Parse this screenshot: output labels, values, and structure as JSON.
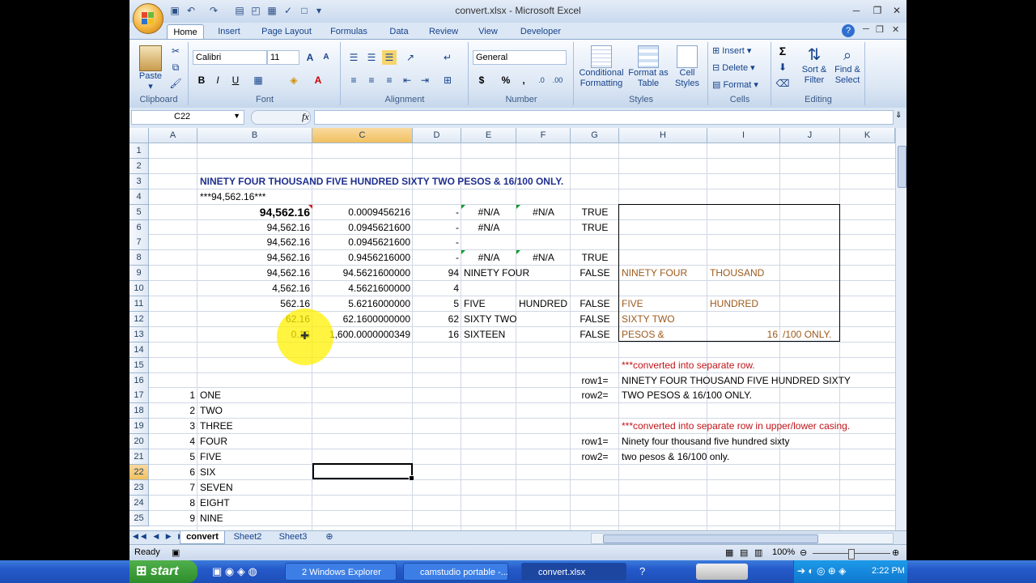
{
  "window": {
    "title": "convert.xlsx - Microsoft Excel"
  },
  "tabs": [
    "Home",
    "Insert",
    "Page Layout",
    "Formulas",
    "Data",
    "Review",
    "View",
    "Developer"
  ],
  "ribbon": {
    "clipboard": {
      "label": "Clipboard",
      "paste": "Paste"
    },
    "font": {
      "label": "Font",
      "name": "Calibri",
      "size": "11",
      "bold": "B",
      "italic": "I",
      "underline": "U"
    },
    "alignment": {
      "label": "Alignment"
    },
    "number": {
      "label": "Number",
      "format": "General",
      "currency": "$",
      "percent": "%",
      "comma": ","
    },
    "styles": {
      "label": "Styles",
      "conditional": "Conditional Formatting",
      "format_table": "Format as Table",
      "cell_styles": "Cell Styles"
    },
    "cells": {
      "label": "Cells",
      "insert": "Insert",
      "delete": "Delete",
      "format": "Format"
    },
    "editing": {
      "label": "Editing",
      "sigma": "Σ",
      "sort": "Sort & Filter",
      "find": "Find & Select"
    }
  },
  "formula_bar": {
    "name_box": "C22",
    "fx": "fx",
    "value": ""
  },
  "columns": [
    "A",
    "B",
    "C",
    "D",
    "E",
    "F",
    "G",
    "H",
    "I",
    "J",
    "K"
  ],
  "rows": [
    "1",
    "2",
    "3",
    "4",
    "5",
    "6",
    "7",
    "8",
    "9",
    "10",
    "11",
    "12",
    "13",
    "14",
    "15",
    "16",
    "17",
    "18",
    "19",
    "20",
    "21",
    "22",
    "23",
    "24",
    "25"
  ],
  "cells": {
    "B3": "NINETY FOUR THOUSAND FIVE HUNDRED SIXTY TWO PESOS & 16/100 ONLY.",
    "B4": "***94,562.16***",
    "B5": "94,562.16",
    "C5": "0.0009456216",
    "D5": "-",
    "E5": "#N/A",
    "F5": "#N/A",
    "G5": "TRUE",
    "B6": "94,562.16",
    "C6": "0.0945621600",
    "D6": "-",
    "E6": "#N/A",
    "G6": "TRUE",
    "B7": "94,562.16",
    "C7": "0.0945621600",
    "D7": "-",
    "B8": "94,562.16",
    "C8": "0.9456216000",
    "D8": "-",
    "E8": "#N/A",
    "F8": "#N/A",
    "G8": "TRUE",
    "B9": "94,562.16",
    "C9": "94.5621600000",
    "D9": "94",
    "E9": "NINETY FOUR",
    "G9": "FALSE",
    "H9": "NINETY FOUR",
    "I9": "THOUSAND",
    "B10": "4,562.16",
    "C10": "4.5621600000",
    "D10": "4",
    "B11": "562.16",
    "C11": "5.6216000000",
    "D11": "5",
    "E11": "FIVE",
    "F11": "HUNDRED",
    "G11": "FALSE",
    "H11": "FIVE",
    "I11": "HUNDRED",
    "B12": "62.16",
    "C12": "62.1600000000",
    "D12": "62",
    "E12": "SIXTY TWO",
    "G12": "FALSE",
    "H12": "SIXTY TWO",
    "B13": "0.16",
    "C13": "1,600.0000000349",
    "D13": "16",
    "E13": "SIXTEEN",
    "G13": "FALSE",
    "H13": "PESOS &",
    "I13": "16",
    "J13": "/100 ONLY.",
    "H15": "***converted into separate row.",
    "G16": "row1=",
    "H16": "NINETY FOUR THOUSAND FIVE HUNDRED SIXTY",
    "A17": "1",
    "B17": "ONE",
    "G17": "row2=",
    "H17": "TWO PESOS & 16/100 ONLY.",
    "A18": "2",
    "B18": "TWO",
    "A19": "3",
    "B19": "THREE",
    "H19": "***converted into separate row in upper/lower casing.",
    "A20": "4",
    "B20": "FOUR",
    "G20": "row1=",
    "H20": "Ninety four thousand five hundred sixty",
    "A21": "5",
    "B21": "FIVE",
    "G21": "row2=",
    "H21": "two pesos & 16/100 only.",
    "A22": "6",
    "B22": "SIX",
    "A23": "7",
    "B23": "SEVEN",
    "A24": "8",
    "B24": "EIGHT",
    "A25": "9",
    "B25": "NINE"
  },
  "sheets": [
    "convert",
    "Sheet2",
    "Sheet3"
  ],
  "status": {
    "ready": "Ready",
    "zoom": "100%"
  },
  "taskbar": {
    "start": "start",
    "items": [
      "2 Windows Explorer",
      "camstudio portable -...",
      "convert.xlsx"
    ],
    "clock": "2:22 PM"
  },
  "colors": {
    "selected_header": "#f1c15f",
    "title_blue": "#1f2f8f",
    "brown": "#9c5a1c",
    "red": "#c0141a"
  }
}
